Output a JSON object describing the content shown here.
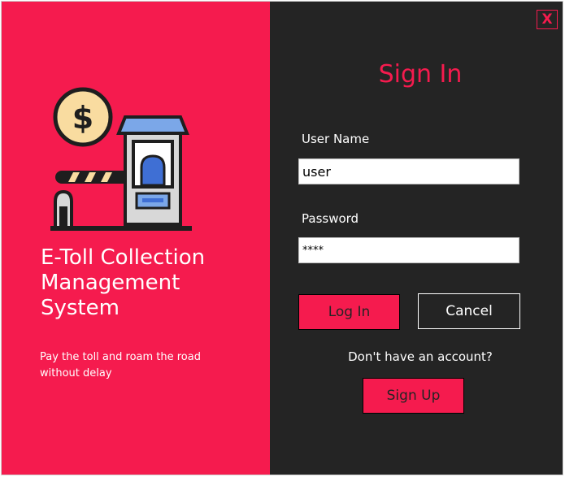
{
  "colors": {
    "accent": "#f51b4e",
    "dark_panel": "#242424",
    "text_light": "#ffffff"
  },
  "brand": {
    "title_lines": [
      "E-Toll Collection",
      "Management",
      "System"
    ],
    "tagline_lines": [
      "Pay the toll and roam the road",
      "without delay"
    ],
    "illustration": "toll-booth-with-barrier-and-dollar-coin"
  },
  "window": {
    "close_label": "X"
  },
  "signin": {
    "title": "Sign In",
    "username_label": "User Name",
    "username_value": "user",
    "password_label": "Password",
    "password_value": "****",
    "login_label": "Log In",
    "cancel_label": "Cancel",
    "account_prompt": "Don't have an account?",
    "signup_label": "Sign Up"
  }
}
